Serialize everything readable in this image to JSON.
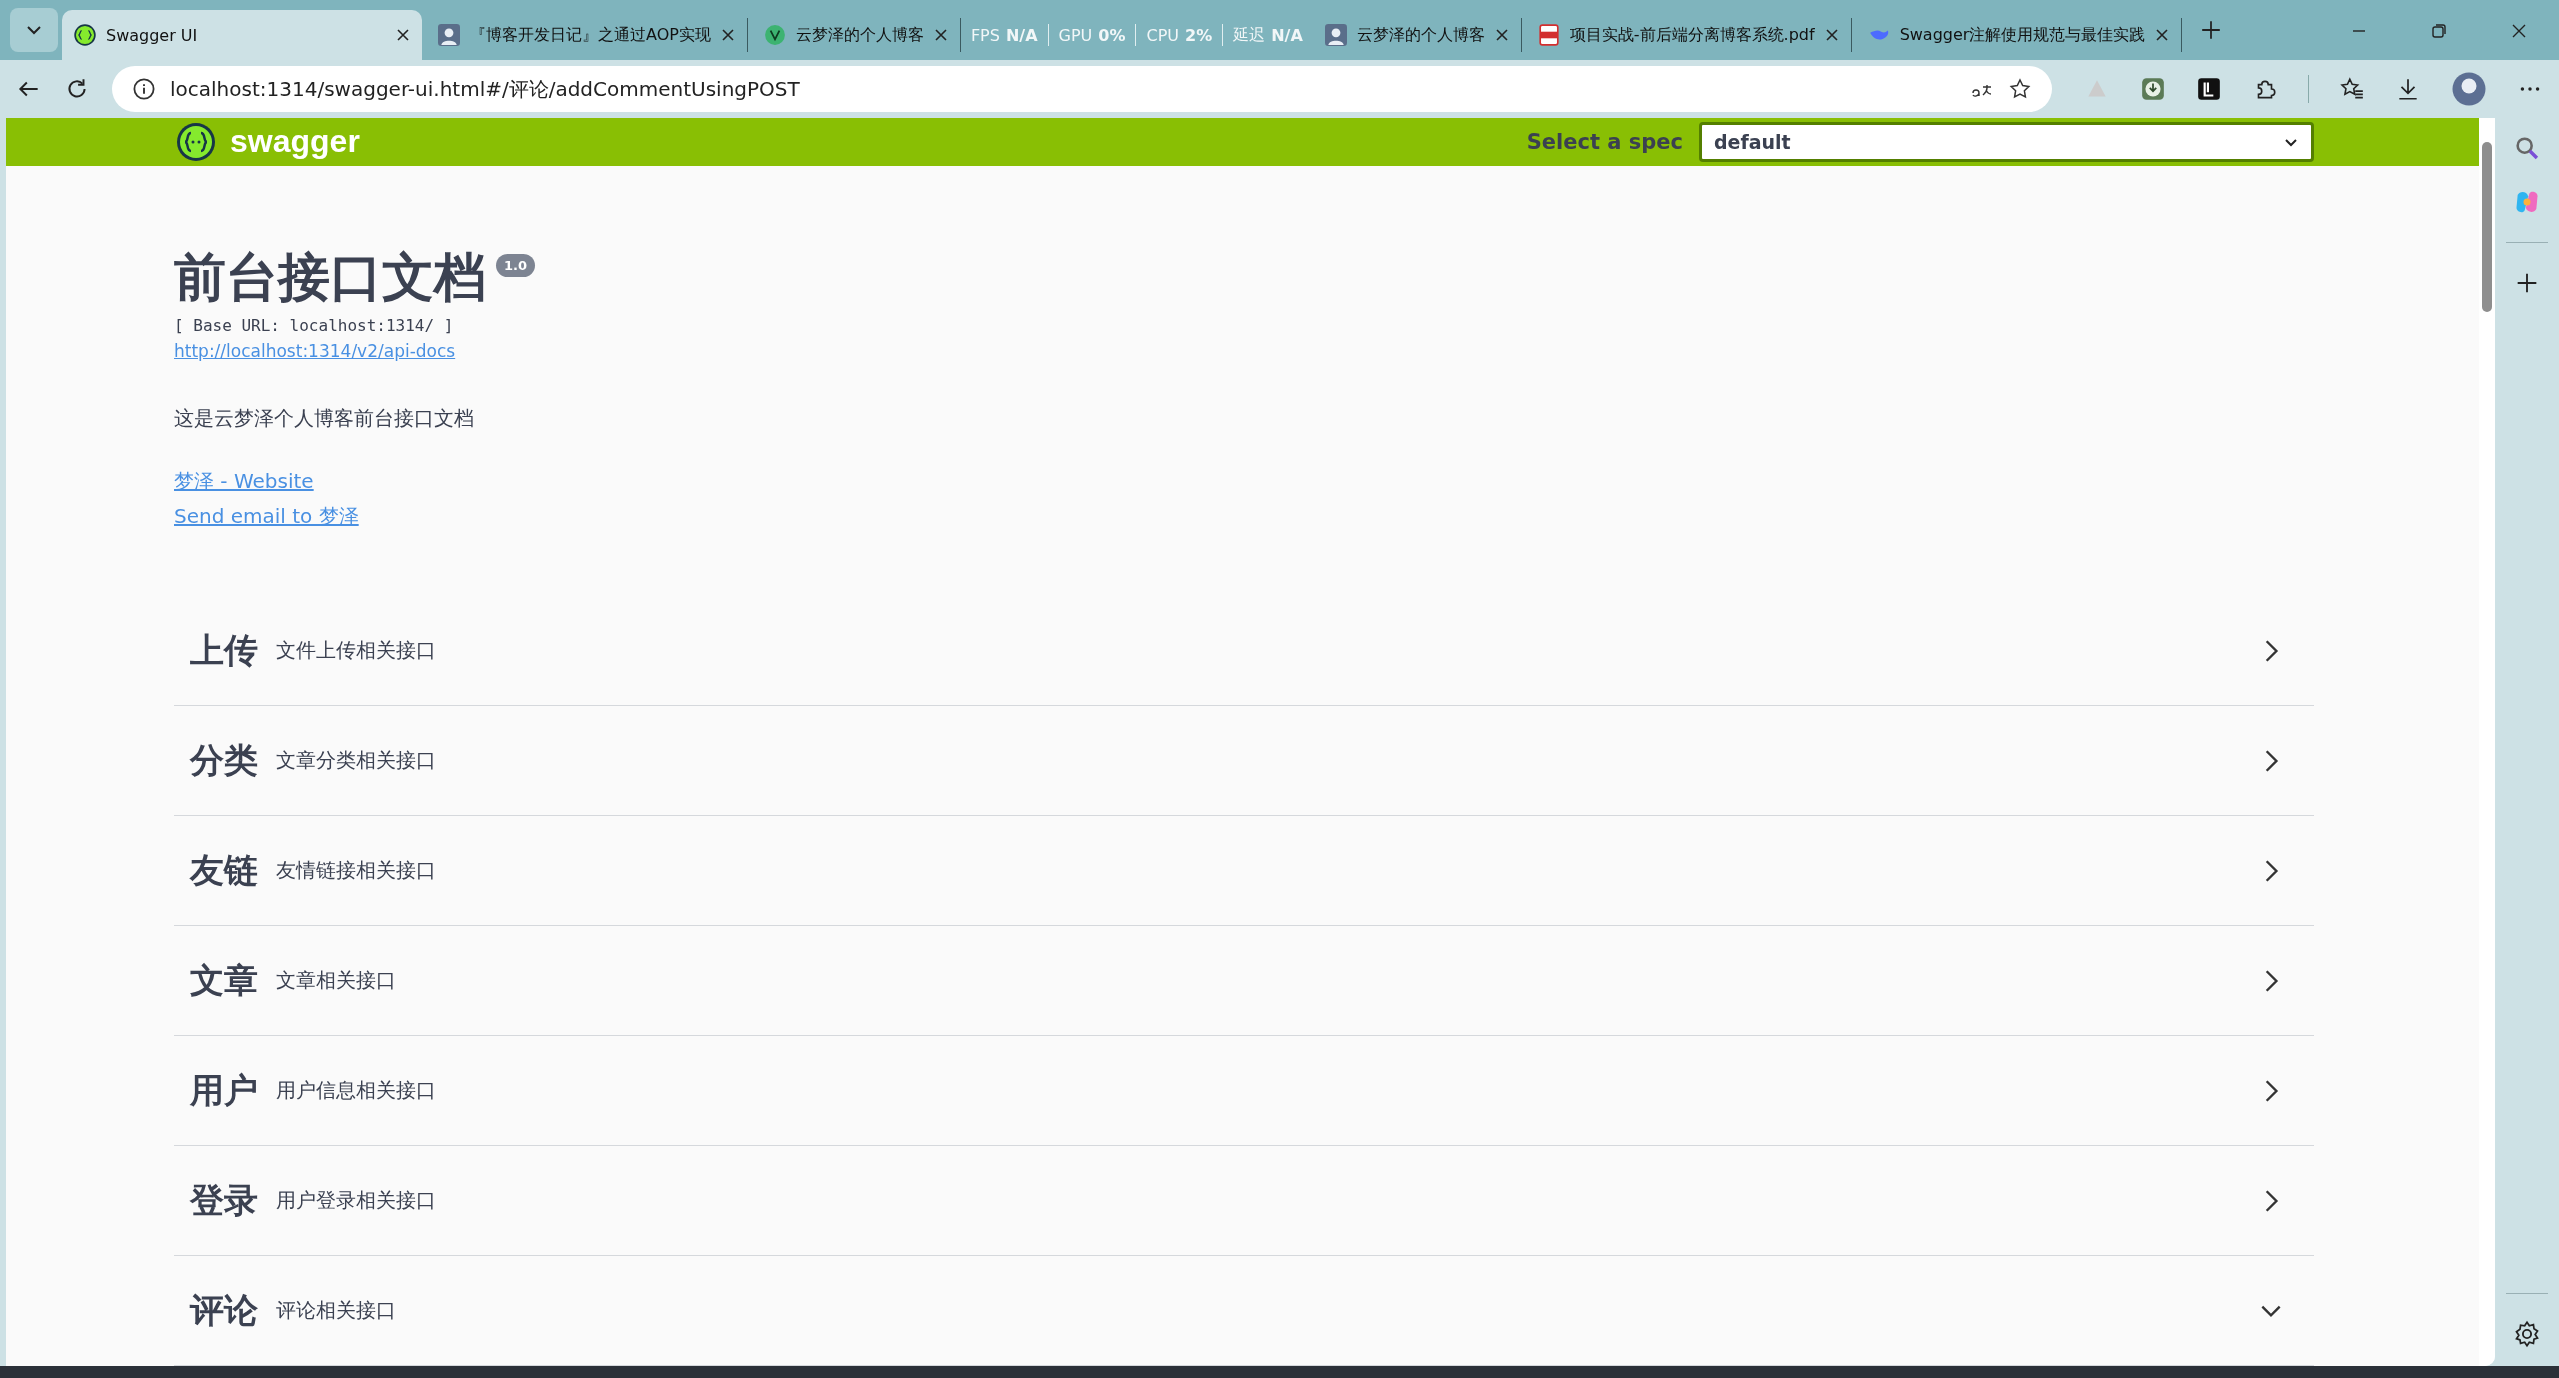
{
  "browser": {
    "tabs": [
      {
        "title": "Swagger UI",
        "kind": "swagger",
        "selected": true
      },
      {
        "title": "『博客开发日记』之通过AOP实现",
        "kind": "avatar",
        "selected": false
      },
      {
        "title": "云梦泽的个人博客",
        "kind": "letter",
        "selected": false
      },
      {
        "title": "云梦泽的个人博客",
        "kind": "avatar",
        "selected": false
      },
      {
        "title": "项目实战-前后端分离博客系统.pdf",
        "kind": "pdf",
        "selected": false
      },
      {
        "title": "Swagger注解使用规范与最佳实践",
        "kind": "bird",
        "selected": false
      }
    ],
    "overlay": [
      {
        "label": "FPS",
        "value": "N/A"
      },
      {
        "label": "GPU",
        "value": "0%"
      },
      {
        "label": "CPU",
        "value": "2%"
      },
      {
        "label": "延迟",
        "value": "N/A"
      }
    ],
    "address": "localhost:1314/swagger-ui.html#/评论/addCommentUsingPOST"
  },
  "swagger": {
    "brand": "swagger",
    "spec_label": "Select a spec",
    "spec_value": "default"
  },
  "info": {
    "title": "前台接口文档",
    "version": "1.0",
    "base_url": "[ Base URL: localhost:1314/ ]",
    "api_docs_link": "http://localhost:1314/v2/api-docs",
    "description": "这是云梦泽个人博客前台接口文档",
    "links": [
      "梦泽 - Website",
      "Send email to 梦泽"
    ]
  },
  "tags": [
    {
      "name": "上传",
      "description": "文件上传相关接口",
      "expanded": false
    },
    {
      "name": "分类",
      "description": "文章分类相关接口",
      "expanded": false
    },
    {
      "name": "友链",
      "description": "友情链接相关接口",
      "expanded": false
    },
    {
      "name": "文章",
      "description": "文章相关接口",
      "expanded": false
    },
    {
      "name": "用户",
      "description": "用户信息相关接口",
      "expanded": false
    },
    {
      "name": "登录",
      "description": "用户登录相关接口",
      "expanded": false
    },
    {
      "name": "评论",
      "description": "评论相关接口",
      "expanded": true
    }
  ]
}
